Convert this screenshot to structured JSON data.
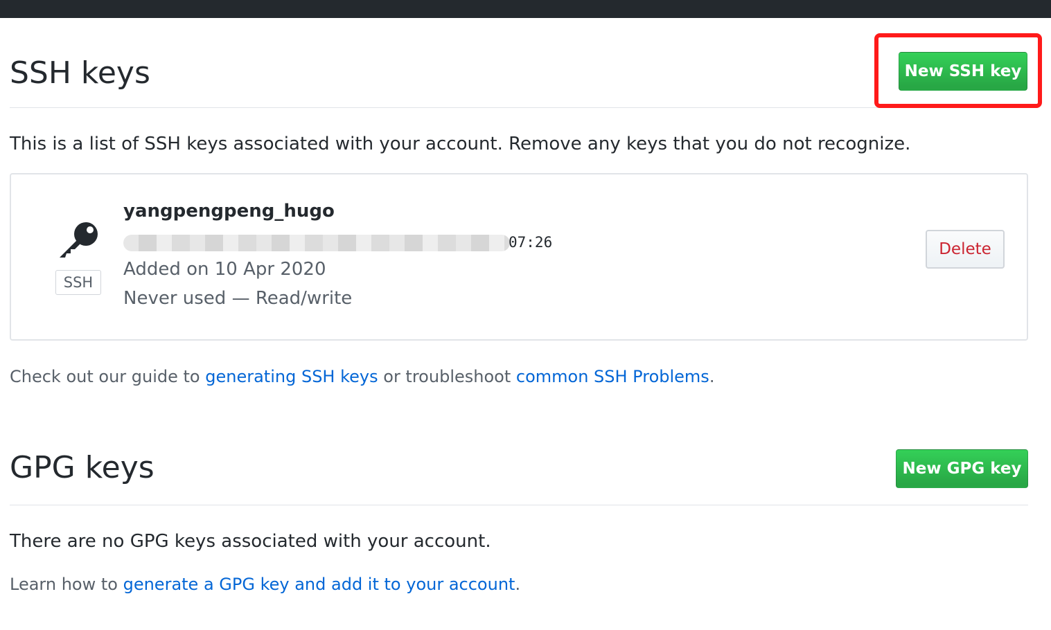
{
  "ssh_section": {
    "title": "SSH keys",
    "new_button_label": "New SSH key",
    "description": "This is a list of SSH keys associated with your account. Remove any keys that you do not recognize.",
    "keys": [
      {
        "title": "yangpengpeng_hugo",
        "fingerprint_visible_tail": "07:26",
        "type_label": "SSH",
        "added": "Added on 10 Apr 2020",
        "usage": "Never used — Read/write",
        "delete_label": "Delete",
        "icon": "key-icon"
      }
    ],
    "guide": {
      "prefix": "Check out our guide to ",
      "link1": "generating SSH keys",
      "middle": " or troubleshoot ",
      "link2": "common SSH Problems",
      "suffix": "."
    }
  },
  "gpg_section": {
    "title": "GPG keys",
    "new_button_label": "New GPG key",
    "empty_message": "There are no GPG keys associated with your account.",
    "learn": {
      "prefix": "Learn how to ",
      "link": "generate a GPG key and add it to your account",
      "suffix": "."
    }
  },
  "colors": {
    "header_bar": "#24292e",
    "primary_button": "#28a745",
    "link": "#0366d6",
    "danger": "#cb2431",
    "highlight": "#ff1a1a"
  }
}
